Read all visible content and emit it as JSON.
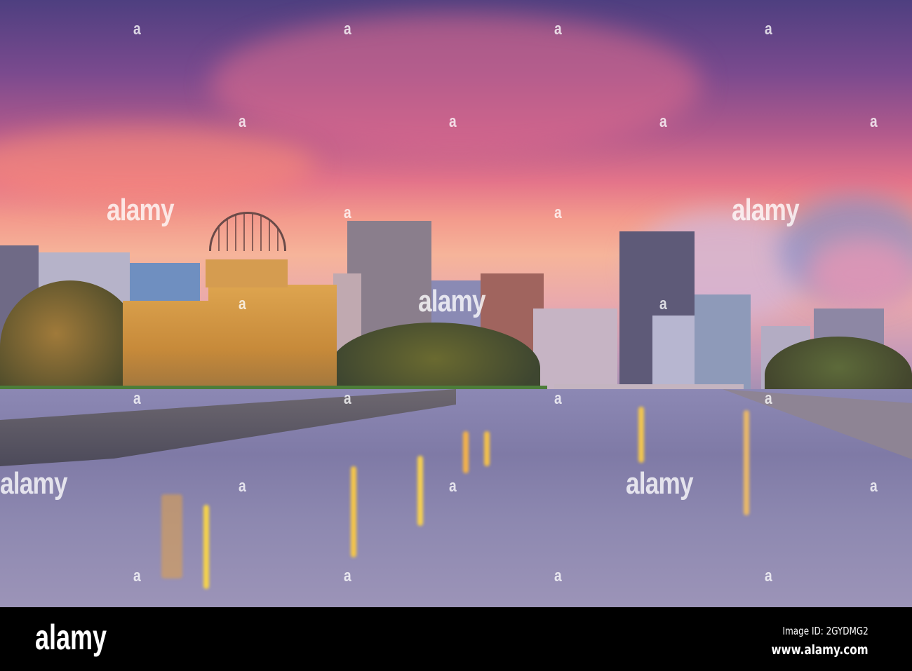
{
  "photo": {
    "subject": "Atomic Bomb Dome by the river at sunset",
    "watermark": "alamy",
    "watermark_small": "a"
  },
  "footer": {
    "logo": "alamy",
    "image_id": "Image ID: 2GYDMG2",
    "website": "www.alamy.com"
  },
  "colors": {
    "sky_top": "#4e3f80",
    "sky_glow": "#f39a8c",
    "river": "#8c88b4",
    "lights": "#ffcf4a"
  }
}
